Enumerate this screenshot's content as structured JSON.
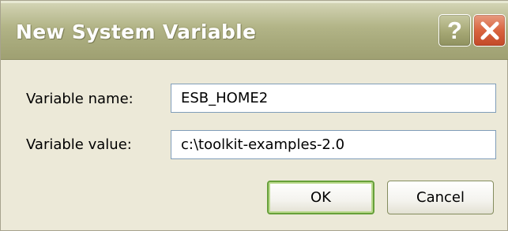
{
  "dialog": {
    "title": "New System Variable",
    "help_glyph": "?",
    "title_icons": [
      "question-icon",
      "close-icon"
    ]
  },
  "form": {
    "name_label": "Variable name:",
    "name_value": "ESB_HOME2",
    "value_label": "Variable value:",
    "value_value": "c:\\toolkit-examples-2.0"
  },
  "buttons": {
    "ok_label": "OK",
    "cancel_label": "Cancel"
  },
  "colors": {
    "titlebar": "#b2b487",
    "close_button": "#d9643f",
    "default_button_border": "#67a03a",
    "window_background": "#ece9d8"
  }
}
